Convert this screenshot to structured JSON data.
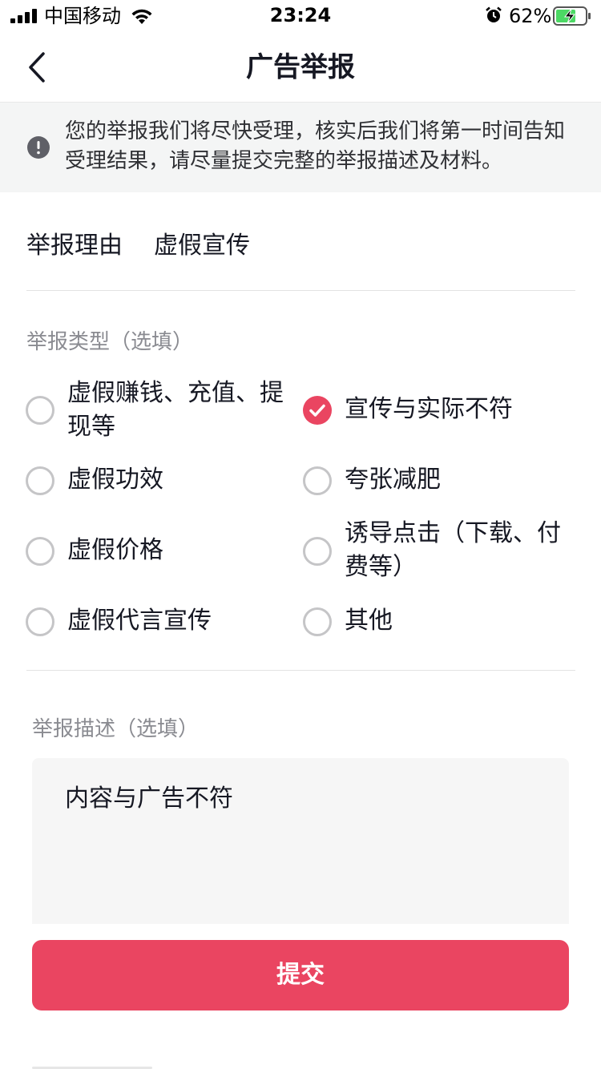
{
  "status_bar": {
    "carrier": "中国移动",
    "time": "23:24",
    "battery_percent": "62%",
    "battery_level": 0.62,
    "icons": [
      "signal-icon",
      "wifi-icon",
      "alarm-icon",
      "battery-charging-icon"
    ]
  },
  "nav": {
    "title": "广告举报",
    "back_icon": "chevron-left-icon"
  },
  "notice": {
    "icon": "exclamation-circle-icon",
    "line1": "您的举报我们将尽快受理，核实后我们将第一时间告知",
    "line2": "受理结果，请尽量提交完整的举报描述及材料。"
  },
  "reason": {
    "label": "举报理由",
    "value": "虚假宣传"
  },
  "report_type": {
    "label": "举报类型（选填）",
    "options": [
      {
        "line1": "虚假赚钱、充值、提",
        "line2": "现等",
        "checked": false
      },
      {
        "line1": "宣传与实际不符",
        "line2": "",
        "checked": true
      },
      {
        "line1": "虚假功效",
        "line2": "",
        "checked": false
      },
      {
        "line1": "夸张减肥",
        "line2": "",
        "checked": false
      },
      {
        "line1": "虚假价格",
        "line2": "",
        "checked": false
      },
      {
        "line1": "诱导点击（下载、付",
        "line2": "费等）",
        "checked": false
      },
      {
        "line1": "虚假代言宣传",
        "line2": "",
        "checked": false
      },
      {
        "line1": "其他",
        "line2": "",
        "checked": false
      }
    ]
  },
  "description": {
    "label": "举报描述（选填）",
    "value": "内容与广告不符"
  },
  "submit": {
    "label": "提交"
  },
  "colors": {
    "accent": "#ea4561",
    "notice_bg": "#f4f5f5",
    "muted_text": "#8a8b91"
  }
}
